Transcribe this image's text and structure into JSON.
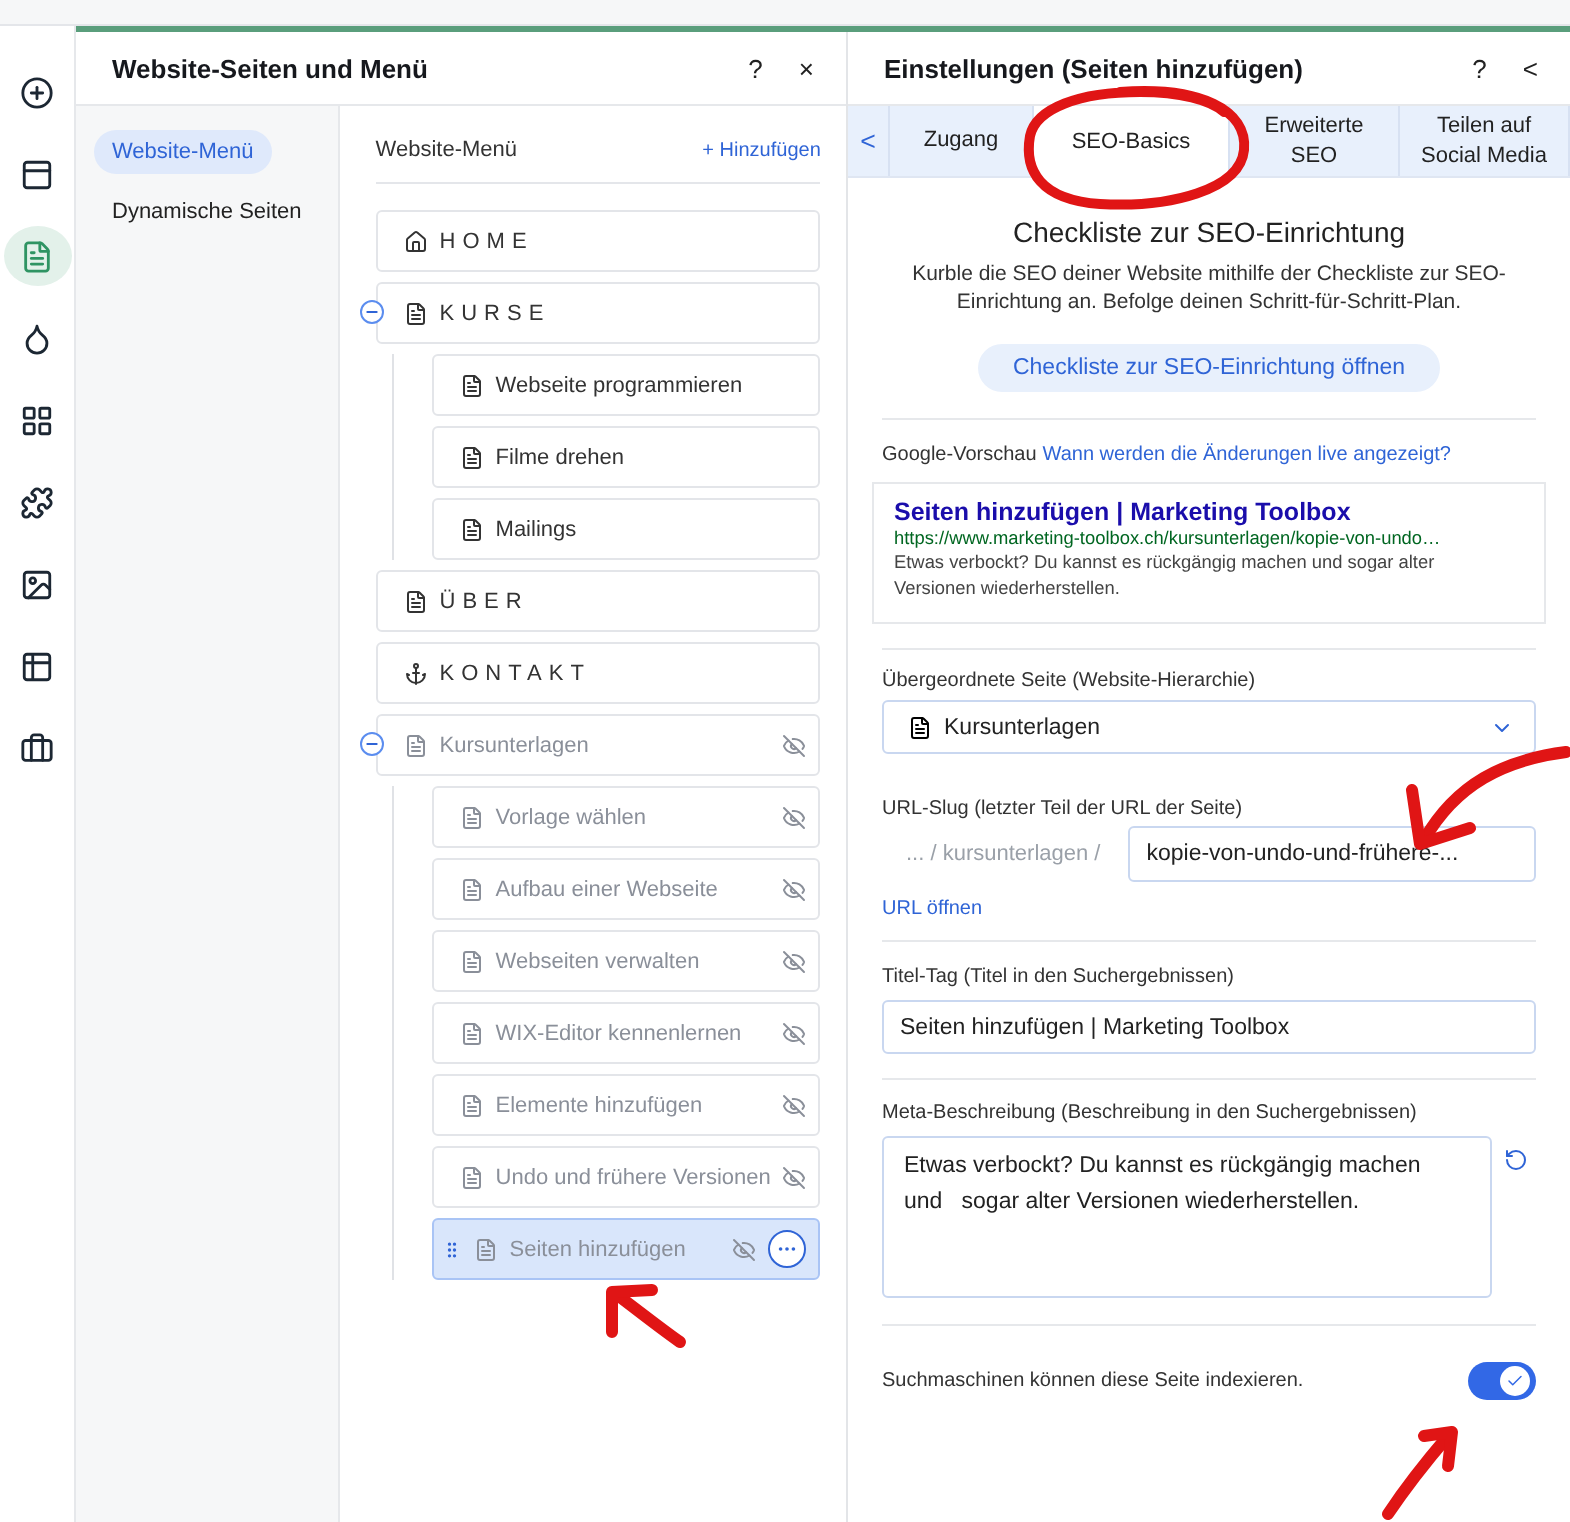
{
  "rail": [
    {
      "selected": false
    },
    {
      "selected": false
    },
    {
      "selected": true
    },
    {
      "selected": false
    },
    {
      "selected": false
    },
    {
      "selected": false
    },
    {
      "selected": false
    },
    {
      "selected": false
    },
    {
      "selected": false
    }
  ],
  "pages_panel": {
    "title": "Website-Seiten und Menü",
    "help": "?",
    "close": "×",
    "sidebar": [
      {
        "label": "Website-Menü",
        "selected": true
      },
      {
        "label": "Dynamische Seiten",
        "selected": false
      }
    ],
    "menu_title": "Website-Menü",
    "add": "+ Hinzufügen",
    "items": [
      {
        "label": "HOME",
        "kind": "home",
        "hidden": false,
        "selected": false
      },
      {
        "label": "KURSE",
        "kind": "section",
        "hidden": false,
        "selected": false,
        "expanded": true,
        "children": [
          {
            "label": "Webseite programmieren",
            "kind": "page",
            "hidden": false,
            "selected": false
          },
          {
            "label": "Filme drehen",
            "kind": "page",
            "hidden": false,
            "selected": false
          },
          {
            "label": "Mailings",
            "kind": "page",
            "hidden": false,
            "selected": false
          }
        ]
      },
      {
        "label": "ÜBER",
        "kind": "section",
        "hidden": false,
        "selected": false
      },
      {
        "label": "KONTAKT",
        "kind": "anchor",
        "hidden": false,
        "selected": false
      },
      {
        "label": "Kursunterlagen",
        "kind": "page",
        "hidden": true,
        "selected": false,
        "expanded": true,
        "children": [
          {
            "label": "Vorlage wählen",
            "kind": "page",
            "hidden": true,
            "selected": false
          },
          {
            "label": "Aufbau einer Webseite",
            "kind": "page",
            "hidden": true,
            "selected": false
          },
          {
            "label": "Webseiten verwalten",
            "kind": "page",
            "hidden": true,
            "selected": false
          },
          {
            "label": "WIX-Editor kennenlernen",
            "kind": "page",
            "hidden": true,
            "selected": false
          },
          {
            "label": "Elemente hinzufügen",
            "kind": "page",
            "hidden": true,
            "selected": false
          },
          {
            "label": "Undo und frühere Versionen",
            "kind": "page",
            "hidden": true,
            "selected": false
          },
          {
            "label": "Seiten hinzufügen",
            "kind": "page",
            "hidden": true,
            "selected": true
          }
        ]
      }
    ]
  },
  "settings_panel": {
    "title": "Einstellungen (Seiten hinzufügen)",
    "help": "?",
    "back": "<",
    "tabs_back": "<",
    "tabs": [
      {
        "label": "Zugang",
        "selected": false
      },
      {
        "label": "SEO-Basics",
        "selected": true
      },
      {
        "label": "Erweiterte SEO",
        "selected": false
      },
      {
        "label": "Teilen auf Social Media",
        "selected": false
      }
    ],
    "checklist": {
      "heading": "Checkliste zur SEO-Einrichtung",
      "text": "Kurble die SEO deiner Website mithilfe der Checkliste zur SEO-Einrichtung an. Befolge deinen Schritt-für-Schritt-Plan.",
      "button": "Checkliste zur SEO-Einrichtung öffnen"
    },
    "google_preview": {
      "label": "Google-Vorschau",
      "link": "Wann werden die Änderungen live angezeigt?",
      "title": "Seiten hinzufügen | Marketing Toolbox",
      "url": "https://www.marketing-toolbox.ch/kursunterlagen/kopie-von-undo…",
      "description": "Etwas verbockt? Du kannst es rückgängig machen und sogar alter Versionen wiederherstellen."
    },
    "parent_page": {
      "label": "Übergeordnete Seite (Website-Hierarchie)",
      "value": "Kursunterlagen"
    },
    "url_slug": {
      "label": "URL-Slug (letzter Teil der URL der Seite)",
      "prefix": "... / kursunterlagen /",
      "value": "kopie-von-undo-und-frühere-...",
      "link": "URL öffnen"
    },
    "title_tag": {
      "label": "Titel-Tag (Titel in den Suchergebnissen)",
      "value": "Seiten hinzufügen | Marketing Toolbox"
    },
    "meta_description": {
      "label": "Meta-Beschreibung (Beschreibung in den Suchergebnissen)",
      "value": "Etwas verbockt? Du kannst es rückgängig machen und   sogar alter Versionen wiederherstellen."
    },
    "indexing": {
      "label": "Suchmaschinen können diese Seite indexieren.",
      "on": true
    }
  },
  "annotations": [
    {
      "kind": "circle"
    },
    {
      "kind": "arrow"
    },
    {
      "kind": "arrow"
    },
    {
      "kind": "arrow"
    }
  ]
}
